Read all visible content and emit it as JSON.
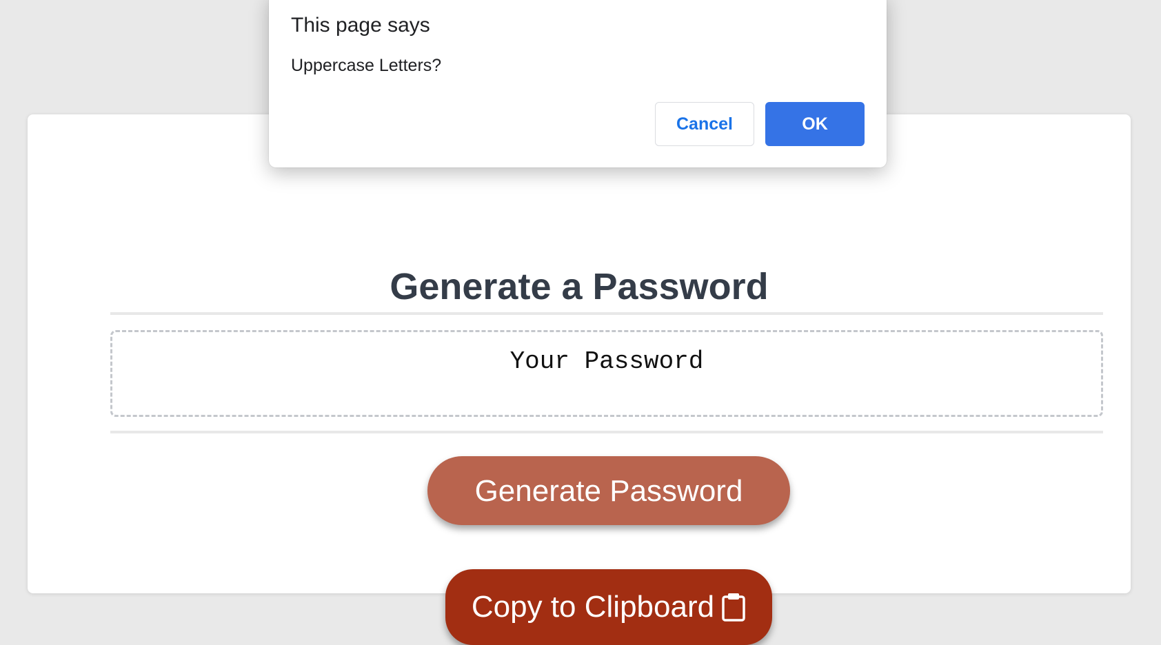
{
  "card": {
    "title": "Generate a Password",
    "password_placeholder": "Your Password",
    "generate_button_label": "Generate Password",
    "copy_button_label": "Copy to Clipboard",
    "copy_button_icon": "clipboard-icon"
  },
  "dialog": {
    "title": "This page says",
    "message": "Uppercase Letters?",
    "cancel_label": "Cancel",
    "ok_label": "OK"
  },
  "colors": {
    "background": "#e9e9e9",
    "title_text": "#343c48",
    "generate_button": "#b9644e",
    "copy_button": "#a22e12",
    "dialog_primary": "#3573e6",
    "dialog_link": "#1a73e8"
  }
}
